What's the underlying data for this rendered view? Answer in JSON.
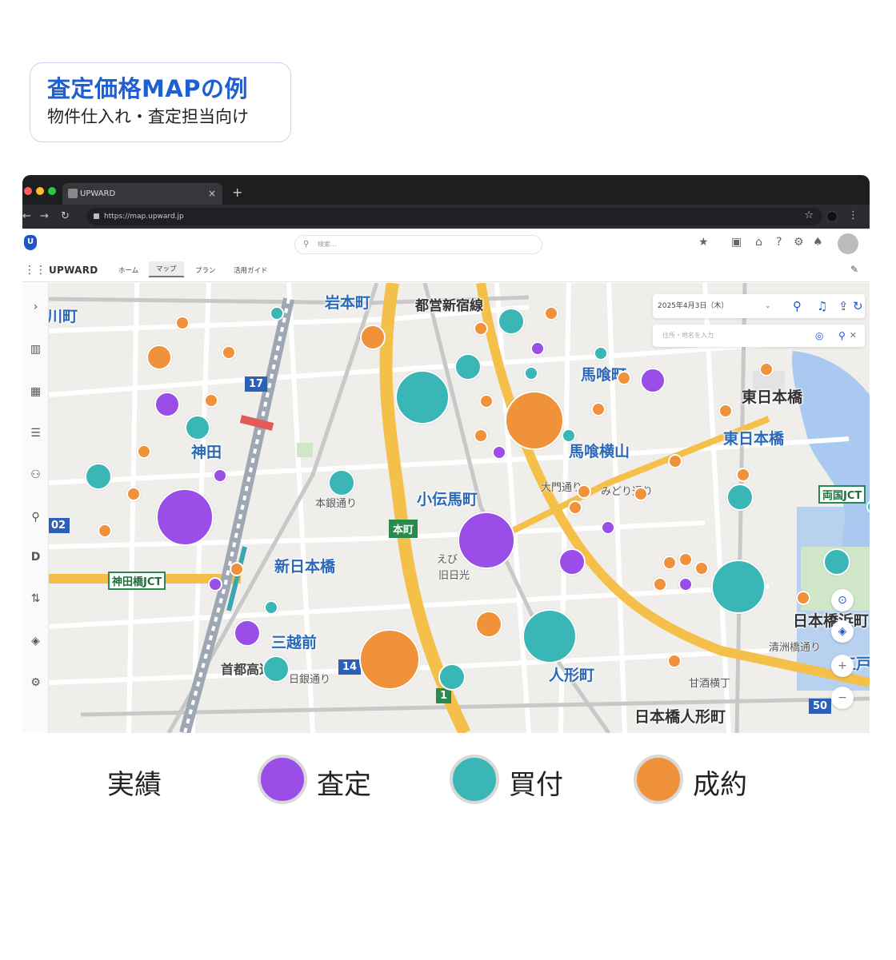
{
  "caption": {
    "title": "査定価格MAPの例",
    "subtitle": "物件仕入れ・査定担当向け"
  },
  "browser": {
    "tab_title": "UPWARD",
    "url": "https://map.upward.jp"
  },
  "app": {
    "brand": "UPWARD",
    "search_placeholder": "検索...",
    "menu": [
      "ホーム",
      "マップ",
      "プラン",
      "活用ガイド"
    ],
    "active_menu": "マップ"
  },
  "map_panel": {
    "date": "2025年4月3日（木）",
    "address_placeholder": "住所・地名を入力"
  },
  "map_labels": {
    "iwamotocho": "岩本町",
    "toei_shinjuku": "都営新宿線",
    "bakurocho": "馬喰町",
    "higashi_nihonbashi_1": "東日本橋",
    "higashi_nihonbashi_2": "東日本橋",
    "bakuro_yokoyama": "馬喰横山",
    "kanda": "神田",
    "kodenmacho": "小伝馬町",
    "honcho": "本町",
    "shin_nihonbashi": "新日本橋",
    "mitsukoshimae": "三越前",
    "ningyocho": "人形町",
    "nihonbashi_ningyocho": "日本橋人形町",
    "nihonbashi_hamacho": "日本橋浜町",
    "ryogoku_jct": "両国JCT",
    "kanda_bashi_jct": "神田橋JCT",
    "kawa_machi": "川町",
    "hongin_dori": "本銀通り",
    "ohdenma_dori": "大門通り",
    "midori_dori": "みどり通り",
    "kiyosubashi_dori": "清洲橋通り",
    "ebisu": "えび",
    "kyu_nikko": "旧日光",
    "shuto": "首都高速都",
    "nihon_ginko": "日銀通り",
    "amazake": "甘酒横丁",
    "edo": "江戸区",
    "route_17": "17",
    "route_14": "14",
    "route_1": "1",
    "route_50": "50",
    "route_02": "02"
  },
  "legend": {
    "title": "実績",
    "items": [
      {
        "label": "査定",
        "color": "#9b4de8"
      },
      {
        "label": "買付",
        "color": "#3bb6b6"
      },
      {
        "label": "成約",
        "color": "#f0923a"
      }
    ]
  },
  "markers": [
    {
      "type": "査定",
      "size": "large",
      "color": "#9b4de8"
    },
    {
      "type": "買付",
      "size": "large",
      "color": "#3bb6b6"
    },
    {
      "type": "成約",
      "size": "large",
      "color": "#f0923a"
    }
  ]
}
